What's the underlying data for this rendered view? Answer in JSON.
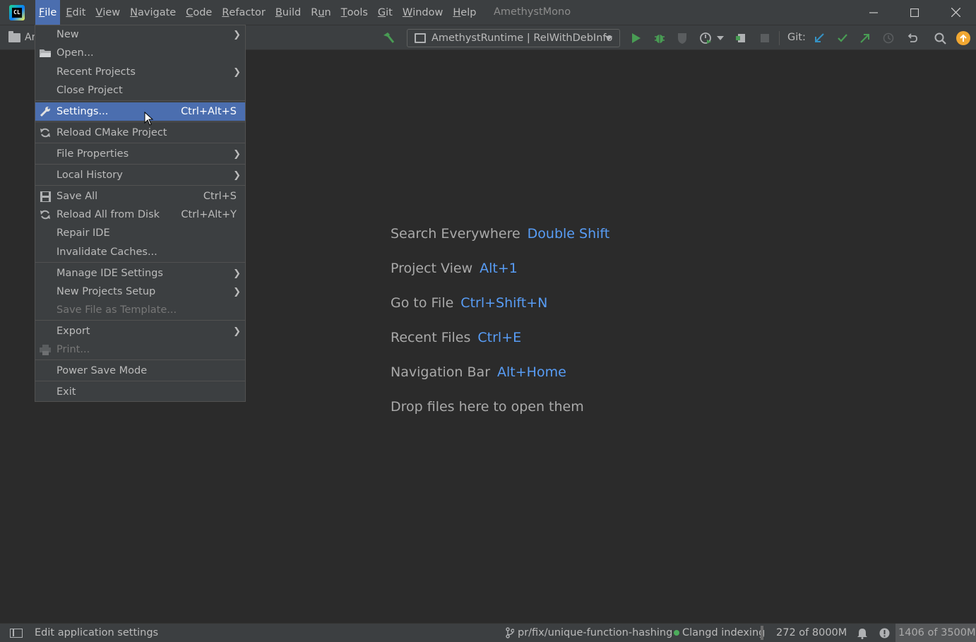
{
  "app": {
    "logo_text": "CL",
    "window_title": "AmethystMono"
  },
  "menubar": {
    "items": [
      {
        "name": "file",
        "pre": "",
        "u": "F",
        "post": "ile"
      },
      {
        "name": "edit",
        "pre": "",
        "u": "E",
        "post": "dit"
      },
      {
        "name": "view",
        "pre": "",
        "u": "V",
        "post": "iew"
      },
      {
        "name": "navigate",
        "pre": "",
        "u": "N",
        "post": "avigate"
      },
      {
        "name": "code",
        "pre": "",
        "u": "C",
        "post": "ode"
      },
      {
        "name": "refactor",
        "pre": "",
        "u": "R",
        "post": "efactor"
      },
      {
        "name": "build",
        "pre": "",
        "u": "B",
        "post": "uild"
      },
      {
        "name": "run",
        "pre": "R",
        "u": "u",
        "post": "n"
      },
      {
        "name": "tools",
        "pre": "",
        "u": "T",
        "post": "ools"
      },
      {
        "name": "git",
        "pre": "",
        "u": "G",
        "post": "it"
      },
      {
        "name": "window",
        "pre": "",
        "u": "W",
        "post": "indow"
      },
      {
        "name": "help",
        "pre": "",
        "u": "H",
        "post": "elp"
      }
    ]
  },
  "toolbar": {
    "project_crumb": "Ar",
    "run_config": "AmethystRuntime | RelWithDebInfo",
    "git_label": "Git:"
  },
  "file_menu": {
    "new": "New",
    "open": "Open...",
    "recent_projects": "Recent Projects",
    "close_project": "Close Project",
    "settings": "Settings...",
    "settings_shortcut": "Ctrl+Alt+S",
    "reload_cmake": "Reload CMake Project",
    "file_properties": "File Properties",
    "local_history": "Local History",
    "save_all": "Save All",
    "save_all_shortcut": "Ctrl+S",
    "reload_disk": "Reload All from Disk",
    "reload_disk_shortcut": "Ctrl+Alt+Y",
    "repair_ide": "Repair IDE",
    "invalidate_caches": "Invalidate Caches...",
    "manage_settings": "Manage IDE Settings",
    "new_projects_setup": "New Projects Setup",
    "save_template": "Save File as Template...",
    "export": "Export",
    "print": "Print...",
    "power_save": "Power Save Mode",
    "exit": "Exit"
  },
  "welcome": {
    "hints": [
      {
        "label": "Search Everywhere",
        "key": "Double Shift"
      },
      {
        "label": "Project View",
        "key": "Alt+1"
      },
      {
        "label": "Go to File",
        "key": "Ctrl+Shift+N"
      },
      {
        "label": "Recent Files",
        "key": "Ctrl+E"
      },
      {
        "label": "Navigation Bar",
        "key": "Alt+Home"
      },
      {
        "label": "Drop files here to open them",
        "key": ""
      }
    ]
  },
  "statusbar": {
    "message": "Edit application settings",
    "branch": "pr/fix/unique-function-hashing",
    "indexing": "Clangd indexing",
    "progress": "272 of 8000M",
    "memory": "1406 of 3500M"
  },
  "colors": {
    "accent": "#4b6eaf",
    "key_hint": "#589df6",
    "run_green": "#499c54",
    "update_orange": "#f0a732"
  }
}
